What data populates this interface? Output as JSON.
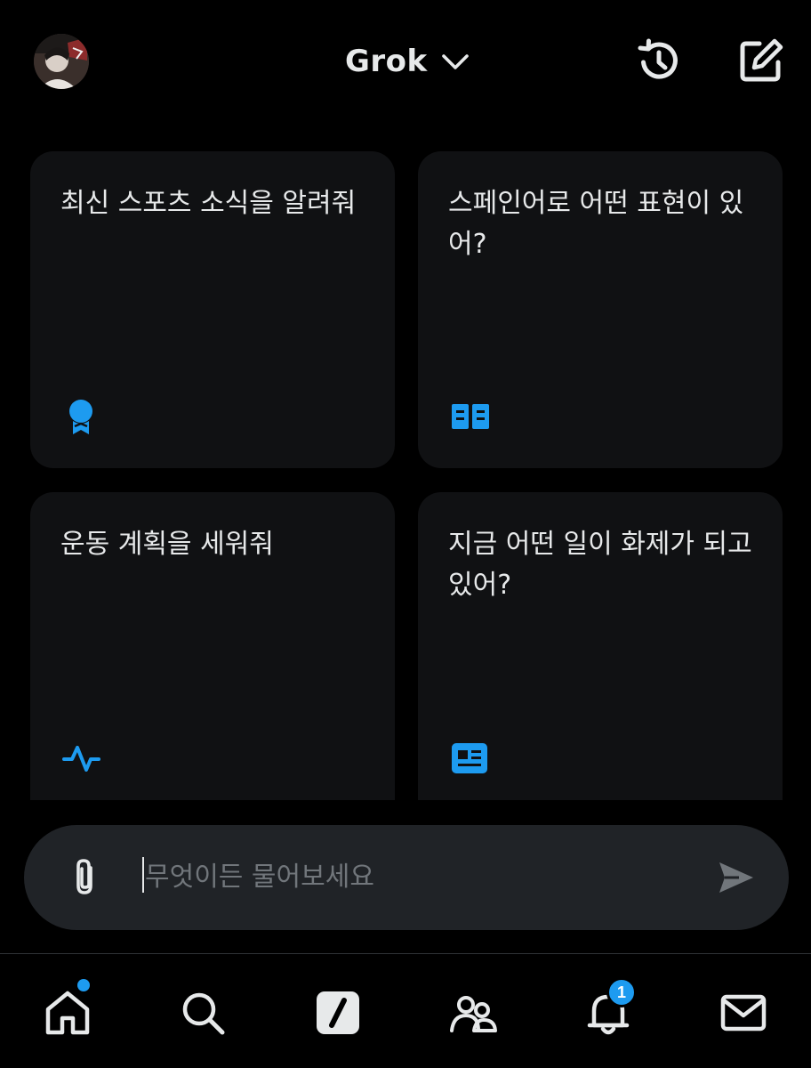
{
  "header": {
    "model_name": "Grok",
    "icons": [
      "avatar",
      "chevron-down-icon",
      "history-icon",
      "compose-icon"
    ]
  },
  "suggestions": [
    {
      "text": "최신 스포츠 소식을 알려줘",
      "icon": "medal-icon"
    },
    {
      "text": "스페인어로 어떤 표현이 있어?",
      "icon": "book-icon"
    },
    {
      "text": "운동 계획을 세워줘",
      "icon": "activity-icon"
    },
    {
      "text": "지금 어떤 일이 화제가 되고 있어?",
      "icon": "news-icon"
    }
  ],
  "composer": {
    "placeholder": "무엇이든 물어보세요",
    "value": ""
  },
  "bottom_nav": {
    "items": [
      "home-icon",
      "search-icon",
      "grok-icon",
      "communities-icon",
      "notifications-icon",
      "messages-icon"
    ],
    "notifications_badge": "1"
  },
  "colors": {
    "background": "#000000",
    "card": "#101113",
    "composer": "#202327",
    "accent": "#1d9bf0",
    "text": "#e7e9ea",
    "muted": "#71767b"
  }
}
